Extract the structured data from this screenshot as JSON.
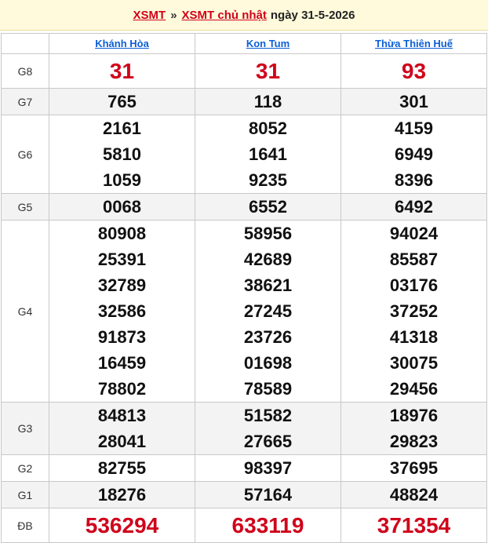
{
  "header": {
    "link1": "XSMT",
    "separator": "»",
    "link2": "XSMT chủ nhật",
    "date_text": "ngày 31-5-2026"
  },
  "provinces": [
    "Khánh Hòa",
    "Kon Tum",
    "Thừa Thiên Huế"
  ],
  "prizes": [
    {
      "label": "G8",
      "values": [
        [
          "31"
        ],
        [
          "31"
        ],
        [
          "93"
        ]
      ]
    },
    {
      "label": "G7",
      "values": [
        [
          "765"
        ],
        [
          "118"
        ],
        [
          "301"
        ]
      ]
    },
    {
      "label": "G6",
      "values": [
        [
          "2161",
          "5810",
          "1059"
        ],
        [
          "8052",
          "1641",
          "9235"
        ],
        [
          "4159",
          "6949",
          "8396"
        ]
      ]
    },
    {
      "label": "G5",
      "values": [
        [
          "0068"
        ],
        [
          "6552"
        ],
        [
          "6492"
        ]
      ]
    },
    {
      "label": "G4",
      "values": [
        [
          "80908",
          "25391",
          "32789",
          "32586",
          "91873",
          "16459",
          "78802"
        ],
        [
          "58956",
          "42689",
          "38621",
          "27245",
          "23726",
          "01698",
          "78589"
        ],
        [
          "94024",
          "85587",
          "03176",
          "37252",
          "41318",
          "30075",
          "29456"
        ]
      ]
    },
    {
      "label": "G3",
      "values": [
        [
          "84813",
          "28041"
        ],
        [
          "51582",
          "27665"
        ],
        [
          "18976",
          "29823"
        ]
      ]
    },
    {
      "label": "G2",
      "values": [
        [
          "82755"
        ],
        [
          "98397"
        ],
        [
          "37695"
        ]
      ]
    },
    {
      "label": "G1",
      "values": [
        [
          "18276"
        ],
        [
          "57164"
        ],
        [
          "48824"
        ]
      ]
    },
    {
      "label": "ĐB",
      "values": [
        [
          "536294"
        ],
        [
          "633119"
        ],
        [
          "371354"
        ]
      ]
    }
  ],
  "colors": {
    "accent_red": "#d0021b",
    "link_blue": "#0b5ed7",
    "header_bg": "#fffadb"
  }
}
